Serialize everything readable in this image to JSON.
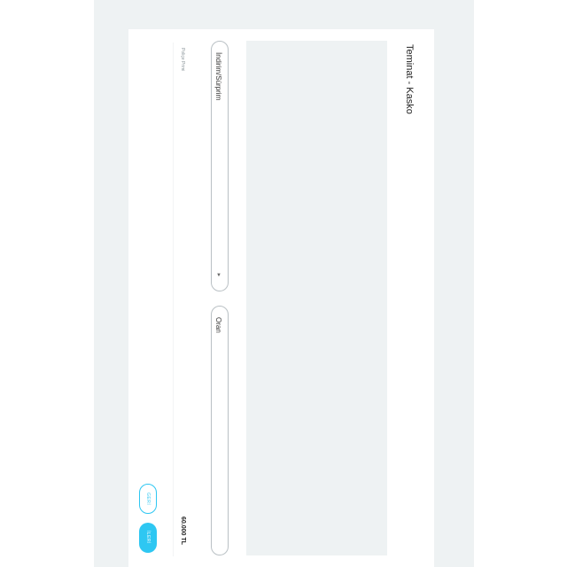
{
  "page": {
    "title": "Teminat - Kasko"
  },
  "form": {
    "discount_label": "İndirim/Sürprim",
    "rate_label": "Oran",
    "premium_label": "Poliçe Primi",
    "premium_value": "60.000 TL"
  },
  "buttons": {
    "back_label": "GERİ",
    "next_label": "İLERİ"
  },
  "colors": {
    "accent": "#2ec7f2",
    "background": "#eef2f3"
  },
  "icons": {
    "dropdown": "chevron-down-icon"
  }
}
